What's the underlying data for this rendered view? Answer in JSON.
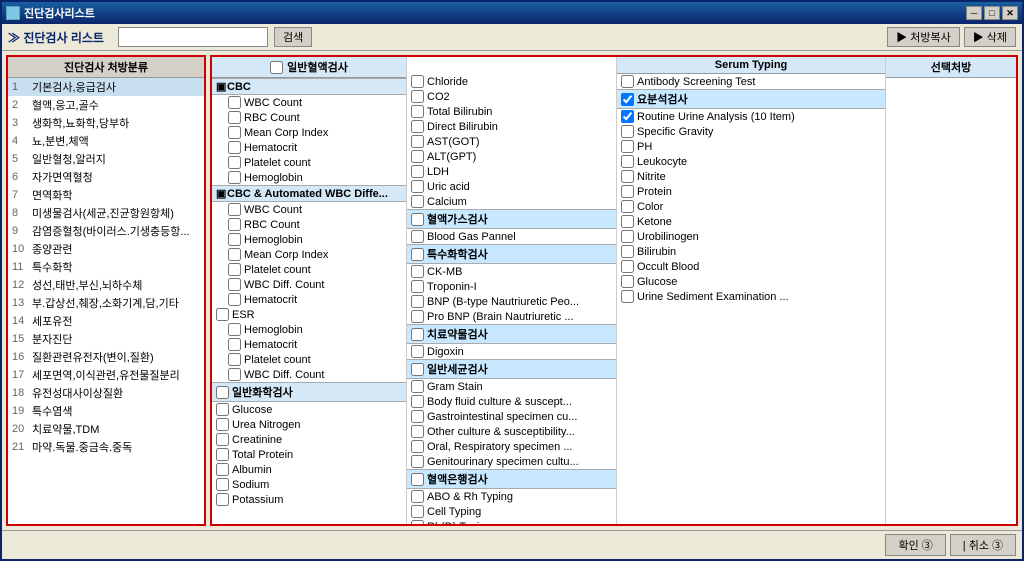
{
  "window": {
    "title": "진단검사리스트",
    "close_btn": "✕",
    "min_btn": "─",
    "max_btn": "□"
  },
  "toolbar": {
    "title": "진단검사 리스트",
    "search_placeholder": "",
    "search_btn": "검색",
    "prescription_btn": "▶ 처방복사",
    "delete_btn": "▶ 삭제"
  },
  "left_panel": {
    "header": "진단검사 처방분류",
    "items": [
      {
        "num": "1",
        "text": "기본검사,응급검사"
      },
      {
        "num": "2",
        "text": "혈액,응고,골수"
      },
      {
        "num": "3",
        "text": "생화학,뇨화학,당부하"
      },
      {
        "num": "4",
        "text": "뇨,분변,체액"
      },
      {
        "num": "5",
        "text": "일반혈청,알러지"
      },
      {
        "num": "6",
        "text": "자가면역혈청"
      },
      {
        "num": "7",
        "text": "면역화학"
      },
      {
        "num": "8",
        "text": "미생물검사(세균,진균항원항체)"
      },
      {
        "num": "9",
        "text": "감염증혈청(바이러스.기생충등항..."
      },
      {
        "num": "10",
        "text": "종양관련"
      },
      {
        "num": "11",
        "text": "특수화학"
      },
      {
        "num": "12",
        "text": "성선,태반,부신,뇌하수체"
      },
      {
        "num": "13",
        "text": "부.갑상선,췌장,소화기계,담,기타"
      },
      {
        "num": "14",
        "text": "세포유전"
      },
      {
        "num": "15",
        "text": "분자진단"
      },
      {
        "num": "16",
        "text": "질환관련유전자(변이,질환)"
      },
      {
        "num": "17",
        "text": "세포면역,이식관련,유전물질분리"
      },
      {
        "num": "18",
        "text": "유전성대사이상질환"
      },
      {
        "num": "19",
        "text": "특수염색"
      },
      {
        "num": "20",
        "text": "치료약물,TDM"
      },
      {
        "num": "21",
        "text": "마약.독물.중금속.중독"
      }
    ]
  },
  "col1": {
    "header": "일반혈액검사",
    "sections": [
      {
        "type": "section",
        "label": "CBC",
        "checked": false,
        "indent": 1,
        "items": [
          {
            "label": "WBC Count",
            "indent": 2,
            "checked": false
          },
          {
            "label": "RBC Count",
            "indent": 2,
            "checked": false
          },
          {
            "label": "Mean Corp Index",
            "indent": 2,
            "checked": false
          },
          {
            "label": "Hematocrit",
            "indent": 2,
            "checked": false
          },
          {
            "label": "Platelet count",
            "indent": 2,
            "checked": false
          },
          {
            "label": "Hemoglobin",
            "indent": 2,
            "checked": false
          }
        ]
      },
      {
        "type": "section",
        "label": "CBC & Automated WBC Diffe...",
        "checked": false,
        "indent": 1,
        "items": [
          {
            "label": "WBC Count",
            "indent": 2,
            "checked": false
          },
          {
            "label": "RBC Count",
            "indent": 2,
            "checked": false
          },
          {
            "label": "Hemoglobin",
            "indent": 2,
            "checked": false
          },
          {
            "label": "Mean Corp Index",
            "indent": 2,
            "checked": false
          },
          {
            "label": "Platelet count",
            "indent": 2,
            "checked": false
          },
          {
            "label": "WBC Diff. Count",
            "indent": 2,
            "checked": false
          },
          {
            "label": "Hematocrit",
            "indent": 2,
            "checked": false
          }
        ]
      },
      {
        "type": "item",
        "label": "ESR",
        "indent": 1,
        "checked": false
      },
      {
        "type": "section",
        "label": "",
        "items": [
          {
            "label": "Hemoglobin",
            "indent": 2,
            "checked": false
          },
          {
            "label": "Hematocrit",
            "indent": 2,
            "checked": false
          },
          {
            "label": "Platelet count",
            "indent": 2,
            "checked": false
          },
          {
            "label": "WBC Diff. Count",
            "indent": 2,
            "checked": false
          }
        ]
      }
    ]
  },
  "col1_bottom": {
    "header": "일반화학검사",
    "items": [
      {
        "label": "Glucose",
        "checked": false
      },
      {
        "label": "Urea Nitrogen",
        "checked": false
      },
      {
        "label": "Creatinine",
        "checked": false
      },
      {
        "label": "Total Protein",
        "checked": false
      },
      {
        "label": "Albumin",
        "checked": false
      },
      {
        "label": "Sodium",
        "checked": false
      },
      {
        "label": "Potassium",
        "checked": false
      }
    ]
  },
  "col2_top": {
    "items": [
      {
        "label": "Chloride",
        "checked": false
      },
      {
        "label": "CO2",
        "checked": false
      },
      {
        "label": "Total Bilirubin",
        "checked": false
      },
      {
        "label": "Direct Bilirubin",
        "checked": false
      },
      {
        "label": "AST(GOT)",
        "checked": false
      },
      {
        "label": "ALT(GPT)",
        "checked": false
      },
      {
        "label": "LDH",
        "checked": false
      },
      {
        "label": "Uric acid",
        "checked": false
      },
      {
        "label": "Calcium",
        "checked": false
      }
    ]
  },
  "col2_blood_gas": {
    "header": "혈액가스검사",
    "items": [
      {
        "label": "Blood Gas Pannel",
        "checked": false
      }
    ]
  },
  "col2_special": {
    "header": "특수화학검사",
    "items": [
      {
        "label": "CK-MB",
        "checked": false
      },
      {
        "label": "Troponin-I",
        "checked": false
      },
      {
        "label": "BNP (B-type Nautriuretic Peo...",
        "checked": false
      },
      {
        "label": "Pro BNP (Brain Nautriuretic ...",
        "checked": false
      }
    ]
  },
  "col2_drug": {
    "header": "치료약물검사",
    "items": [
      {
        "label": "Digoxin",
        "checked": false
      }
    ]
  },
  "col2_bacteria": {
    "header": "일반세균검사",
    "items": [
      {
        "label": "Gram Stain",
        "checked": false
      },
      {
        "label": "Body fluid  culture & suscept...",
        "checked": false
      },
      {
        "label": "Gastrointestinal specimen cu...",
        "checked": false
      },
      {
        "label": "Other culture & susceptibility...",
        "checked": false
      },
      {
        "label": "Oral, Respiratory specimen ...",
        "checked": false
      },
      {
        "label": "Genitourinary specimen cultu...",
        "checked": false
      }
    ]
  },
  "col2_blood_bank": {
    "header": "혈액은행검사",
    "items": [
      {
        "label": "ABO  & Rh Typing",
        "checked": false
      },
      {
        "label": "Cell Typing",
        "checked": false
      },
      {
        "label": "Rh(D) Typing",
        "checked": false
      }
    ]
  },
  "col3_serum": {
    "header": "Serum Typing",
    "items": [
      {
        "label": "Antibody Screening Test",
        "checked": false
      }
    ]
  },
  "col3_urine": {
    "header": "요분석검사",
    "checked": true,
    "items": [
      {
        "label": "Routine Urine Analysis (10 Item)",
        "checked": true
      },
      {
        "label": "Specific Gravity",
        "checked": false
      },
      {
        "label": "PH",
        "checked": false
      },
      {
        "label": "Leukocyte",
        "checked": false
      },
      {
        "label": "Nitrite",
        "checked": false
      },
      {
        "label": "Protein",
        "checked": false
      },
      {
        "label": "Color",
        "checked": false
      },
      {
        "label": "Ketone",
        "checked": false
      },
      {
        "label": "Urobilinogen",
        "checked": false
      },
      {
        "label": "Bilirubin",
        "checked": false
      },
      {
        "label": "Occult Blood",
        "checked": false
      },
      {
        "label": "Glucose",
        "checked": false
      },
      {
        "label": "Urine Sediment Examination ...",
        "checked": false
      }
    ]
  },
  "right_panel": {
    "header": "선택처방"
  },
  "bottom": {
    "confirm_btn": "확인 ③",
    "cancel_btn": "| 취소 ③"
  }
}
